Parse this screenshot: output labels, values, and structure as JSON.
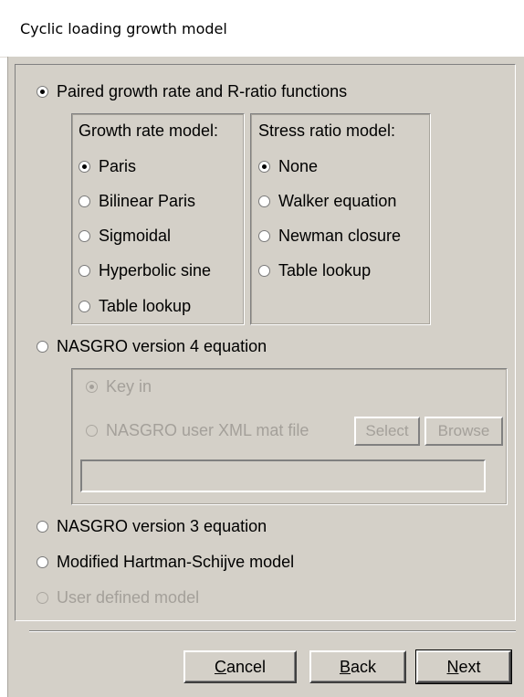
{
  "window": {
    "title": "Cyclic loading growth model"
  },
  "options": {
    "paired": {
      "label": "Paired growth rate and R-ratio functions",
      "checked": true
    },
    "nasgro4": {
      "label": "NASGRO version 4 equation",
      "checked": false
    },
    "nasgro3": {
      "label": "NASGRO version 3 equation",
      "checked": false
    },
    "hartman": {
      "label": "Modified Hartman-Schijve model",
      "checked": false
    },
    "user_defined": {
      "label": "User defined model",
      "checked": false,
      "enabled": false
    }
  },
  "growth_rate": {
    "heading": "Growth rate model:",
    "items": [
      {
        "label": "Paris",
        "checked": true
      },
      {
        "label": "Bilinear Paris",
        "checked": false
      },
      {
        "label": "Sigmoidal",
        "checked": false
      },
      {
        "label": "Hyperbolic sine",
        "checked": false
      },
      {
        "label": "Table lookup",
        "checked": false
      }
    ]
  },
  "stress_ratio": {
    "heading": "Stress ratio model:",
    "items": [
      {
        "label": "None",
        "checked": true
      },
      {
        "label": "Walker equation",
        "checked": false
      },
      {
        "label": "Newman closure",
        "checked": false
      },
      {
        "label": "Table lookup",
        "checked": false
      }
    ]
  },
  "nasgro4_panel": {
    "key_in": {
      "label": "Key in",
      "checked": true
    },
    "xml_file": {
      "label": "NASGRO user XML mat file",
      "checked": false
    },
    "select_label": "Select",
    "browse_label": "Browse",
    "file_value": "",
    "enabled": false
  },
  "buttons": {
    "cancel": {
      "prefix": "",
      "key": "C",
      "rest": "ancel"
    },
    "back": {
      "prefix": "",
      "key": "B",
      "rest": "ack"
    },
    "next": {
      "prefix": "",
      "key": "N",
      "rest": "ext"
    }
  }
}
